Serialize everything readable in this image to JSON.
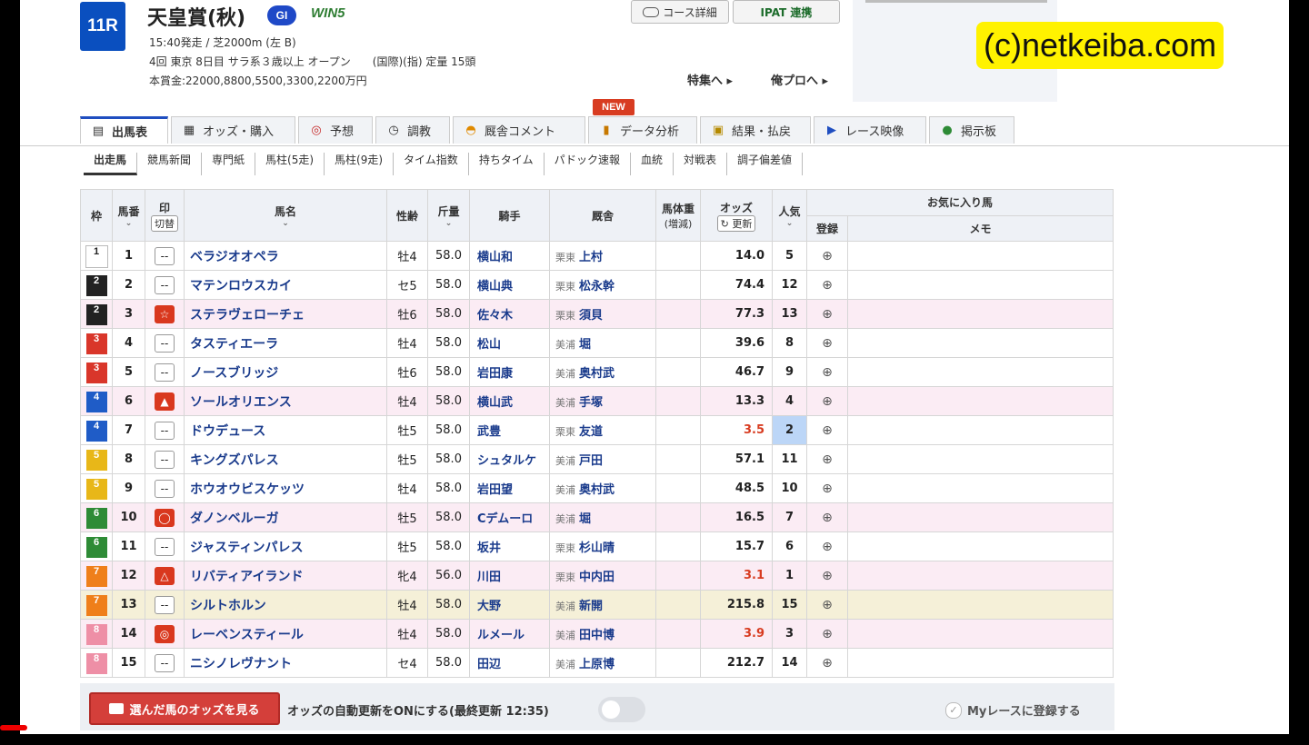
{
  "race": {
    "number": "11R",
    "title": "天皇賞(秋)",
    "grade": "GI",
    "win5": "WIN5",
    "line1": "15:40発走 / 芝2000m (左 B)",
    "line2": "4回 東京 8日目 サラ系３歳以上 オープン　　(国際)(指) 定量 15頭",
    "prize": "本賞金:22000,8800,5500,3300,2200万円"
  },
  "top_buttons": {
    "course": "コース詳細",
    "ipat": "IPAT 連携"
  },
  "links": {
    "special": "特集へ ▸",
    "pro": "俺プロへ ▸"
  },
  "watermark": "(c)netkeiba.com",
  "new_badge": "NEW",
  "tabs": [
    {
      "label": "出馬表",
      "icon": "card-icon"
    },
    {
      "label": "オッズ・購入",
      "icon": "ticket-icon"
    },
    {
      "label": "予想",
      "icon": "target-icon"
    },
    {
      "label": "調教",
      "icon": "clock-icon"
    },
    {
      "label": "厩舎コメント",
      "icon": "helmet-icon"
    },
    {
      "label": "データ分析",
      "icon": "bar-chart-icon"
    },
    {
      "label": "結果・払戻",
      "icon": "result-icon"
    },
    {
      "label": "レース映像",
      "icon": "video-icon"
    },
    {
      "label": "掲示板",
      "icon": "chat-icon"
    }
  ],
  "subnav": [
    "出走馬",
    "競馬新聞",
    "専門紙",
    "馬柱(5走)",
    "馬柱(9走)",
    "タイム指数",
    "持ちタイム",
    "パドック速報",
    "血統",
    "対戦表",
    "調子偏差値"
  ],
  "table_header": {
    "waku": "枠",
    "umaban": "馬番",
    "mark": "印",
    "mark_switch": "切替",
    "name": "馬名",
    "sexage": "性齢",
    "weight": "斤量",
    "jockey": "騎手",
    "trainer": "厩舎",
    "body": "馬体重",
    "body_sub": "(増減)",
    "odds": "オッズ",
    "update": "更新",
    "pop": "人気",
    "favorites": "お気に入り馬",
    "register": "登録",
    "memo": "メモ"
  },
  "colors": {
    "waku": {
      "1": "#ffffff",
      "2": "#222222",
      "3": "#d9362a",
      "4": "#1f5cc7",
      "5": "#e8b718",
      "6": "#2e8b36",
      "7": "#ef7f1a",
      "8": "#ee8fa6"
    },
    "waku_text": {
      "1": "#222222",
      "2": "#ffffff",
      "3": "#ffffff",
      "4": "#ffffff",
      "5": "#ffffff",
      "6": "#ffffff",
      "7": "#ffffff",
      "8": "#ffffff"
    },
    "pop1": "#fbe37a",
    "pop2": "#bcd6f7",
    "pop3": "#f3b78f"
  },
  "horses": [
    {
      "waku": "1",
      "num": "1",
      "mark": "--",
      "name": "ベラジオオペラ",
      "sexage": "牡4",
      "weight": "58.0",
      "jockey": "横山和",
      "stable": "栗東",
      "trainer": "上村",
      "odds": "14.0",
      "pop": "5"
    },
    {
      "waku": "2",
      "num": "2",
      "mark": "--",
      "name": "マテンロウスカイ",
      "sexage": "セ5",
      "weight": "58.0",
      "jockey": "横山典",
      "stable": "栗東",
      "trainer": "松永幹",
      "odds": "74.4",
      "pop": "12"
    },
    {
      "waku": "2",
      "num": "3",
      "mark": "☆",
      "name": "ステラヴェローチェ",
      "sexage": "牡6",
      "weight": "58.0",
      "jockey": "佐々木",
      "stable": "栗東",
      "trainer": "須貝",
      "odds": "77.3",
      "pop": "13"
    },
    {
      "waku": "3",
      "num": "4",
      "mark": "--",
      "name": "タスティエーラ",
      "sexage": "牡4",
      "weight": "58.0",
      "jockey": "松山",
      "stable": "美浦",
      "trainer": "堀",
      "odds": "39.6",
      "pop": "8"
    },
    {
      "waku": "3",
      "num": "5",
      "mark": "--",
      "name": "ノースブリッジ",
      "sexage": "牡6",
      "weight": "58.0",
      "jockey": "岩田康",
      "stable": "美浦",
      "trainer": "奥村武",
      "odds": "46.7",
      "pop": "9"
    },
    {
      "waku": "4",
      "num": "6",
      "mark": "▲",
      "name": "ソールオリエンス",
      "sexage": "牡4",
      "weight": "58.0",
      "jockey": "横山武",
      "stable": "美浦",
      "trainer": "手塚",
      "odds": "13.3",
      "pop": "4"
    },
    {
      "waku": "4",
      "num": "7",
      "mark": "--",
      "name": "ドウデュース",
      "sexage": "牡5",
      "weight": "58.0",
      "jockey": "武豊",
      "stable": "栗東",
      "trainer": "友道",
      "odds": "3.5",
      "pop": "2"
    },
    {
      "waku": "5",
      "num": "8",
      "mark": "--",
      "name": "キングズパレス",
      "sexage": "牡5",
      "weight": "58.0",
      "jockey": "シュタルケ",
      "stable": "美浦",
      "trainer": "戸田",
      "odds": "57.1",
      "pop": "11"
    },
    {
      "waku": "5",
      "num": "9",
      "mark": "--",
      "name": "ホウオウビスケッツ",
      "sexage": "牡4",
      "weight": "58.0",
      "jockey": "岩田望",
      "stable": "美浦",
      "trainer": "奥村武",
      "odds": "48.5",
      "pop": "10"
    },
    {
      "waku": "6",
      "num": "10",
      "mark": "◯",
      "name": "ダノンベルーガ",
      "sexage": "牡5",
      "weight": "58.0",
      "jockey": "Cデムーロ",
      "stable": "美浦",
      "trainer": "堀",
      "odds": "16.5",
      "pop": "7"
    },
    {
      "waku": "6",
      "num": "11",
      "mark": "--",
      "name": "ジャスティンパレス",
      "sexage": "牡5",
      "weight": "58.0",
      "jockey": "坂井",
      "stable": "栗東",
      "trainer": "杉山晴",
      "odds": "15.7",
      "pop": "6"
    },
    {
      "waku": "7",
      "num": "12",
      "mark": "△",
      "name": "リバティアイランド",
      "sexage": "牝4",
      "weight": "56.0",
      "jockey": "川田",
      "stable": "栗東",
      "trainer": "中内田",
      "odds": "3.1",
      "pop": "1"
    },
    {
      "waku": "7",
      "num": "13",
      "mark": "--",
      "name": "シルトホルン",
      "sexage": "牡4",
      "weight": "58.0",
      "jockey": "大野",
      "stable": "美浦",
      "trainer": "新開",
      "odds": "215.8",
      "pop": "15"
    },
    {
      "waku": "8",
      "num": "14",
      "mark": "◎",
      "name": "レーベンスティール",
      "sexage": "牡4",
      "weight": "58.0",
      "jockey": "ルメール",
      "stable": "美浦",
      "trainer": "田中博",
      "odds": "3.9",
      "pop": "3"
    },
    {
      "waku": "8",
      "num": "15",
      "mark": "--",
      "name": "ニシノレヴナント",
      "sexage": "セ4",
      "weight": "58.0",
      "jockey": "田辺",
      "stable": "美浦",
      "trainer": "上原博",
      "odds": "212.7",
      "pop": "14"
    }
  ],
  "bottom": {
    "view_odds": "選んだ馬のオッズを見る",
    "auto_update": "オッズの自動更新をONにする(最終更新 12:35)",
    "my_race": "Myレースに登録する"
  }
}
